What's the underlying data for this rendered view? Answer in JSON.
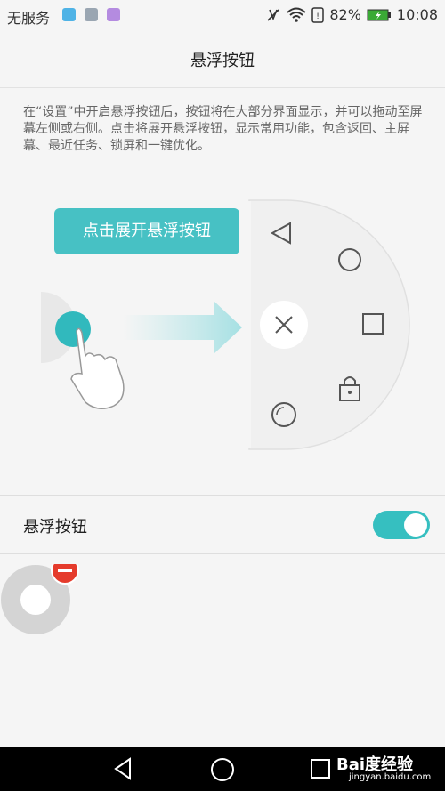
{
  "status_bar": {
    "carrier": "无服务",
    "battery_percent": "82%",
    "time": "10:08",
    "icons": [
      "health-app-icon",
      "gallery-app-icon",
      "keyboard-app-icon",
      "mute-icon",
      "wifi-icon",
      "sim-icon",
      "battery-charging-icon"
    ]
  },
  "header": {
    "title": "悬浮按钮"
  },
  "description": "在“设置”中开启悬浮按钮后，按钮将在大部分界面显示，并可以拖动至屏幕左侧或右侧。点击将展开悬浮按钮，显示常用功能，包含返回、主屏幕、最近任务、锁屏和一键优化。",
  "illustration": {
    "tooltip": "点击展开悬浮按钮",
    "menu_icons": [
      "back-icon",
      "home-icon",
      "recents-icon",
      "lock-icon",
      "optimize-icon",
      "close-icon"
    ]
  },
  "setting": {
    "label": "悬浮按钮",
    "enabled": true
  },
  "colors": {
    "accent": "#36bfc0",
    "tooltip": "#47c1c4",
    "remove_badge": "#e53b2c"
  },
  "navbar": {
    "buttons": [
      "nav-back-icon",
      "nav-home-icon",
      "nav-recents-icon"
    ]
  },
  "watermark": {
    "brand": "Bai度经验",
    "url": "jingyan.baidu.com"
  }
}
